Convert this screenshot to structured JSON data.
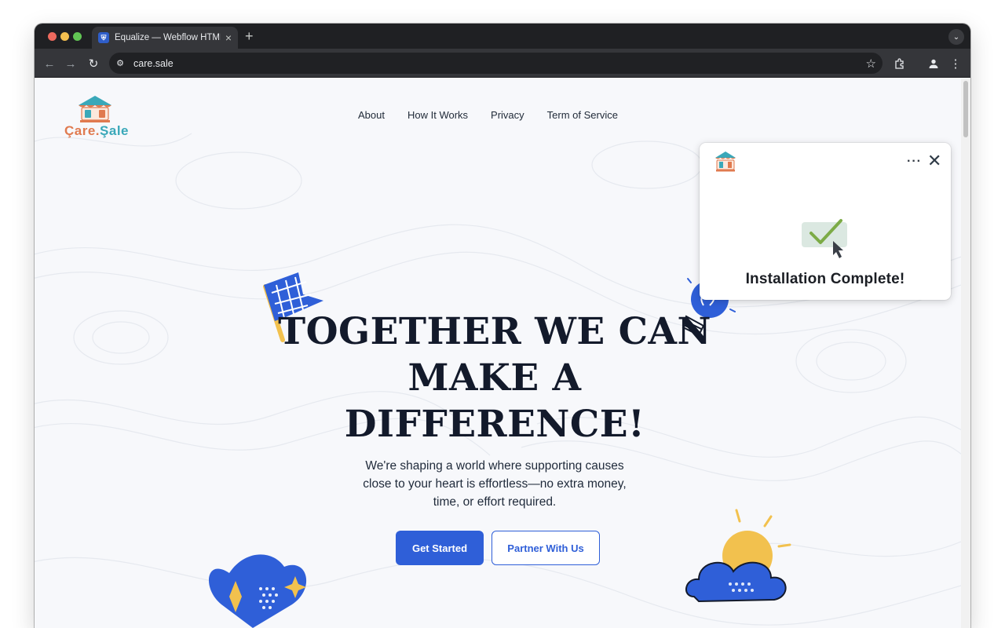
{
  "browser": {
    "tab_title": "Equalize — Webflow HTML w",
    "tab_favicon": "shield-icon",
    "url": "care.sale"
  },
  "site": {
    "logo_text_a": "Çare.",
    "logo_text_b": "Şale",
    "nav": [
      "About",
      "How It Works",
      "Privacy",
      "Term of Service"
    ]
  },
  "hero": {
    "headline_line1": "TOGETHER WE CAN",
    "headline_line2": "MAKE A",
    "headline_line3": "DIFFERENCE!",
    "lead_line1": "We're shaping a world where supporting causes",
    "lead_line2": "close to your heart is effortless—no extra money,",
    "lead_line3": "time, or effort required.",
    "primary_cta": "Get Started",
    "secondary_cta": "Partner With Us"
  },
  "popup": {
    "title": "Installation Complete!",
    "more_label": "···",
    "close_label": "✕"
  },
  "colors": {
    "brand_blue": "#2f5fd8",
    "logo_orange": "#e07a4f",
    "logo_teal": "#3aa8b9",
    "accent_yellow": "#f2c14e"
  }
}
